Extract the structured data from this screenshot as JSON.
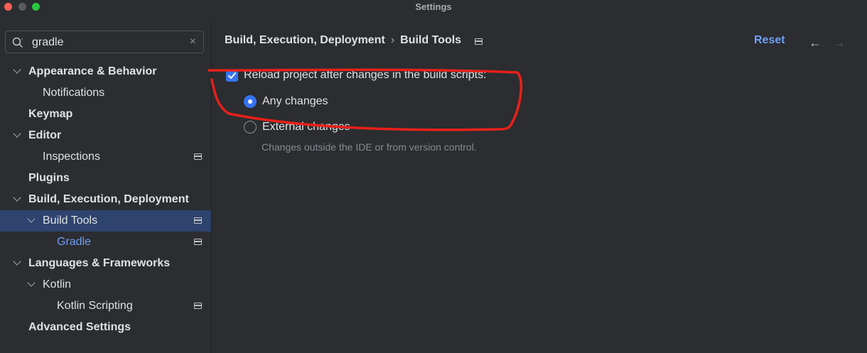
{
  "window": {
    "title": "Settings"
  },
  "search": {
    "value": "gradle",
    "icon": "search-icon",
    "clear_icon": "close-icon",
    "clear_glyph": "×"
  },
  "tree": {
    "items": [
      {
        "label": "Appearance & Behavior",
        "expanded": true
      },
      {
        "label": "Notifications"
      },
      {
        "label": "Keymap"
      },
      {
        "label": "Editor",
        "expanded": true
      },
      {
        "label": "Inspections"
      },
      {
        "label": "Plugins"
      },
      {
        "label": "Build, Execution, Deployment",
        "expanded": true
      },
      {
        "label": "Build Tools",
        "expanded": true,
        "selected": true
      },
      {
        "label": "Gradle"
      },
      {
        "label": "Languages & Frameworks",
        "expanded": true
      },
      {
        "label": "Kotlin",
        "expanded": true
      },
      {
        "label": "Kotlin Scripting"
      },
      {
        "label": "Advanced Settings"
      }
    ]
  },
  "header": {
    "breadcrumb_parent": "Build, Execution, Deployment",
    "breadcrumb_sep": "›",
    "breadcrumb_current": "Build Tools",
    "reset_label": "Reset",
    "back_glyph": "←",
    "forward_glyph": "→"
  },
  "content": {
    "reload_checkbox_label": "Reload project after changes in the build scripts:",
    "reload_checked": true,
    "option_any": "Any changes",
    "option_external": "External changes",
    "selected_option": "Any changes",
    "external_hint": "Changes outside the IDE or from version control."
  },
  "colors": {
    "accent": "#3574f0",
    "link": "#6f9ff5",
    "selection": "#2e436e",
    "annotation": "#e8201a"
  }
}
